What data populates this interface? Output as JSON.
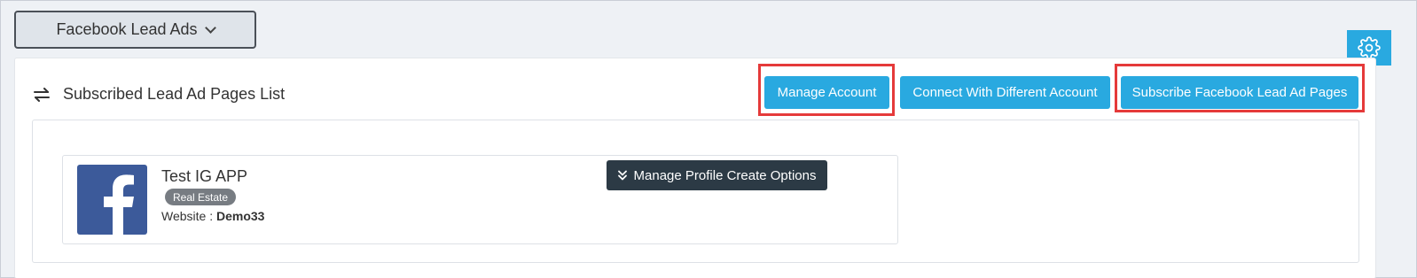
{
  "toolbar": {
    "app_selector_label": "Facebook Lead Ads"
  },
  "panel": {
    "title": "Subscribed Lead Ad Pages List",
    "buttons": {
      "manage_account": "Manage Account",
      "connect_different": "Connect With Different Account",
      "subscribe_pages": "Subscribe Facebook Lead Ad Pages"
    }
  },
  "page_card": {
    "name": "Test IG APP",
    "category_badge": "Real Estate",
    "website_label": "Website : ",
    "website_value": "Demo33",
    "manage_options_label": "Manage Profile Create Options"
  },
  "colors": {
    "accent_blue": "#29a9e0",
    "dark_button": "#2c3a45",
    "highlight_red": "#e53a3a",
    "facebook_blue": "#3c5a9a"
  },
  "icons": {
    "header_icon": "swap-arrows-icon",
    "settings": "gear-icon",
    "dropdown": "chevron-down-icon",
    "manage_options": "double-chevron-down-icon",
    "page_avatar": "facebook-logo-icon"
  }
}
